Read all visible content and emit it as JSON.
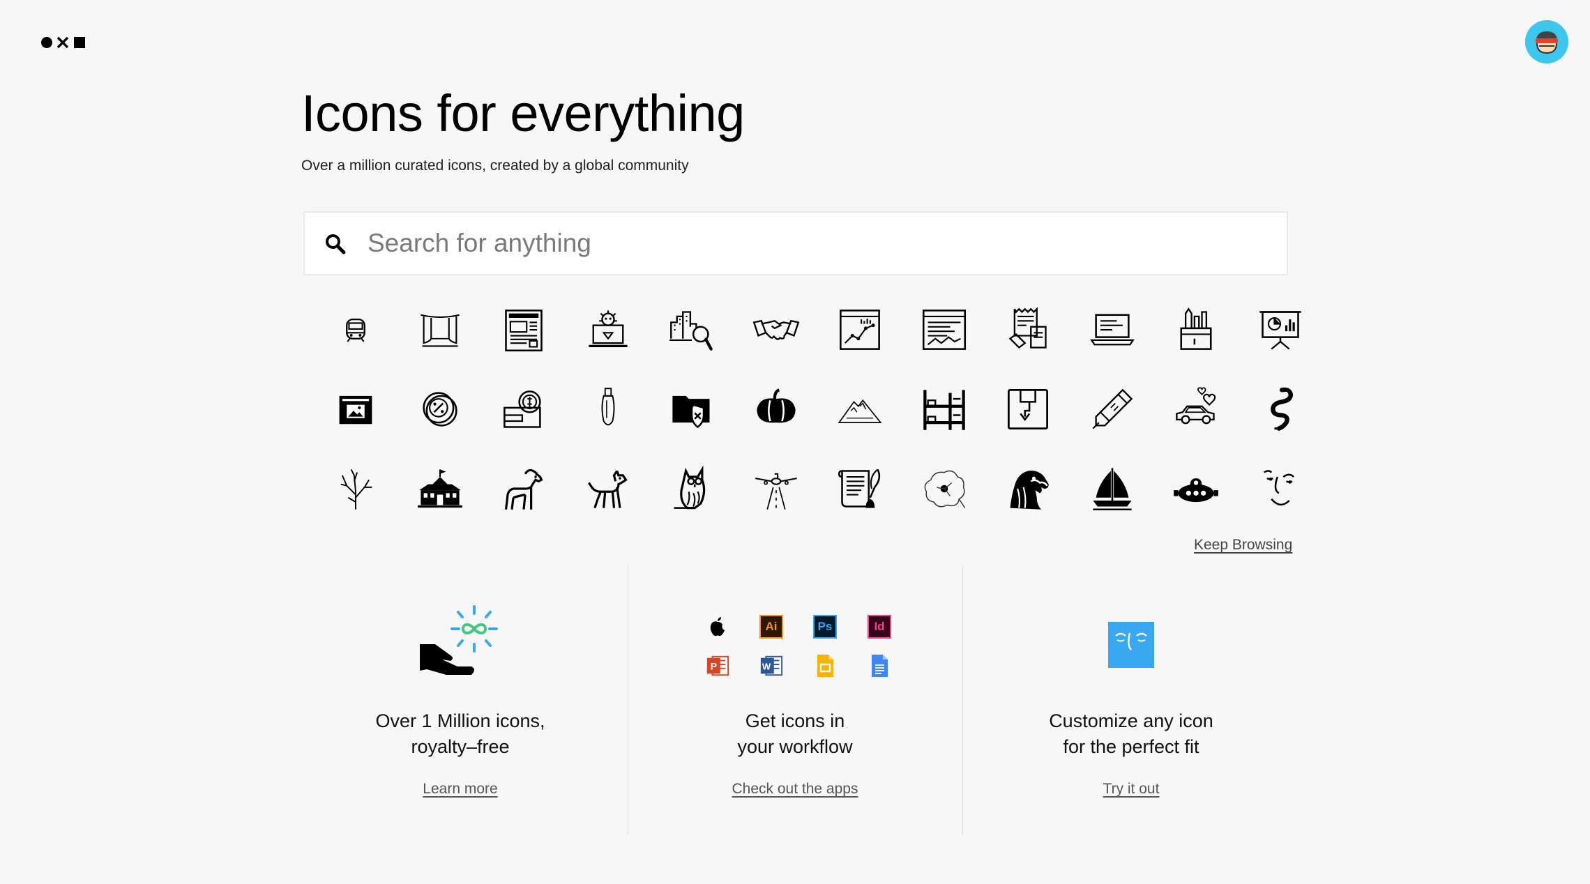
{
  "header": {
    "logo_icon": "noun-project-logo-icon",
    "avatar_icon": "user-avatar-icon",
    "avatar_color": "#3ec7ec"
  },
  "hero": {
    "title": "Icons for everything",
    "subtitle": "Over a million curated icons, created by a global community"
  },
  "search": {
    "placeholder": "Search for anything",
    "value": "",
    "icon": "search-icon"
  },
  "icon_grid": [
    [
      "train-front-icon",
      "stage-curtain-icon",
      "newspaper-icon",
      "laptop-virus-icon",
      "city-search-icon",
      "handshake-icon",
      "analytics-chart-icon",
      "website-dashboard-icon",
      "document-sign-icon",
      "laptop-code-icon",
      "desk-supplies-icon",
      "presentation-board-icon"
    ],
    [
      "image-window-icon",
      "discount-coin-icon",
      "money-wallet-icon",
      "bulb-pendant-icon",
      "shield-folder-icon",
      "pumpkin-icon",
      "mountain-icon",
      "bunk-bed-icon",
      "package-return-icon",
      "pencil-eraser-icon",
      "car-love-icon",
      "snake-icon"
    ],
    [
      "plant-sprout-icon",
      "school-building-icon",
      "goat-icon",
      "dog-icon",
      "owl-icon",
      "airport-plane-icon",
      "certificate-quill-icon",
      "poppy-flower-icon",
      "eagle-head-icon",
      "sailboat-icon",
      "submarine-icon",
      "face-line-icon"
    ]
  ],
  "keep_browsing": "Keep Browsing",
  "features": [
    {
      "icon": "hand-infinity-icon",
      "title": "Over 1 Million icons,\nroyalty–free",
      "link": "Learn more"
    },
    {
      "icon": "app-integrations-icon",
      "title": "Get icons in\nyour workflow",
      "link": "Check out the apps",
      "apps": [
        {
          "name": "apple-icon",
          "label": ""
        },
        {
          "name": "illustrator-icon",
          "label": "Ai"
        },
        {
          "name": "photoshop-icon",
          "label": "Ps"
        },
        {
          "name": "indesign-icon",
          "label": "Id"
        },
        {
          "name": "powerpoint-icon",
          "label": "P"
        },
        {
          "name": "word-icon",
          "label": "W"
        },
        {
          "name": "google-slides-icon",
          "label": ""
        },
        {
          "name": "google-docs-icon",
          "label": ""
        }
      ]
    },
    {
      "icon": "customize-face-icon",
      "title": "Customize any icon\nfor the perfect fit",
      "link": "Try it out"
    }
  ],
  "colors": {
    "background": "#f7f7f7",
    "accent_blue": "#3aa8f0",
    "infinity_green": "#43c783",
    "avatar_cyan": "#3ec7ec",
    "avatar_red": "#e5412c"
  }
}
